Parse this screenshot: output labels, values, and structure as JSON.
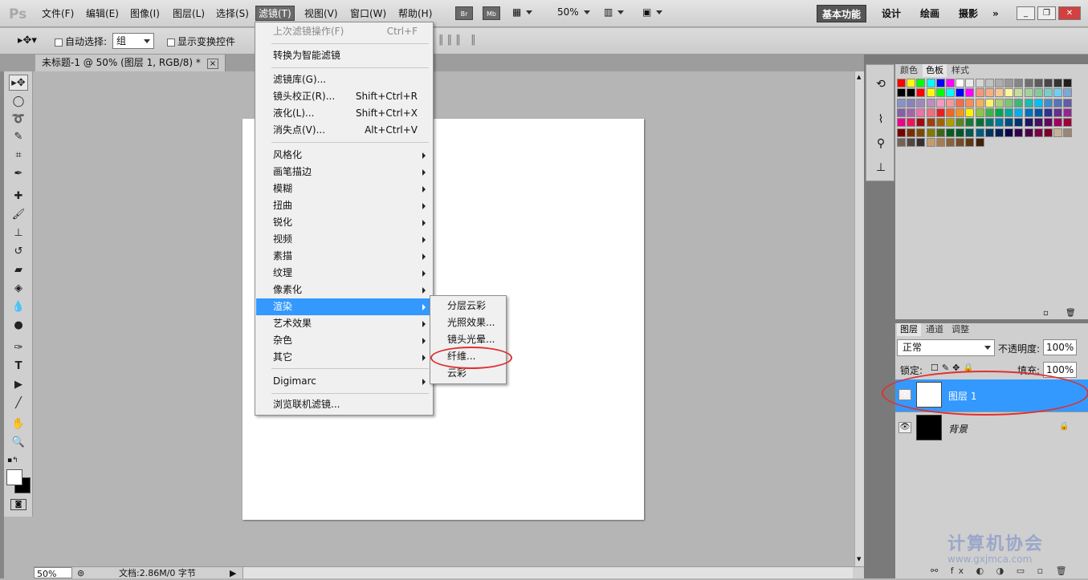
{
  "app": {
    "logo": "Ps"
  },
  "menubar": {
    "items": [
      "文件(F)",
      "编辑(E)",
      "图像(I)",
      "图层(L)",
      "选择(S)",
      "滤镜(T)",
      "视图(V)",
      "窗口(W)",
      "帮助(H)"
    ],
    "bridge_label": "Br",
    "minibridge_label": "Mb",
    "zoom": "50%",
    "workspaces": [
      "基本功能",
      "设计",
      "绘画",
      "摄影"
    ],
    "more": "»"
  },
  "options": {
    "auto_select_label": "自动选择:",
    "auto_select_value": "组",
    "show_transform_label": "显示变换控件"
  },
  "document_tab": {
    "title": "未标题-1 @ 50% (图层 1, RGB/8) *",
    "close": "×"
  },
  "filter_menu": {
    "last_filter": "上次滤镜操作(F)",
    "last_filter_sc": "Ctrl+F",
    "smart": "转换为智能滤镜",
    "gallery": "滤镜库(G)...",
    "lens": "镜头校正(R)...",
    "lens_sc": "Shift+Ctrl+R",
    "liquify": "液化(L)...",
    "liquify_sc": "Shift+Ctrl+X",
    "vanish": "消失点(V)...",
    "vanish_sc": "Alt+Ctrl+V",
    "groups": [
      "风格化",
      "画笔描边",
      "模糊",
      "扭曲",
      "锐化",
      "视频",
      "素描",
      "纹理",
      "像素化",
      "渲染",
      "艺术效果",
      "杂色",
      "其它"
    ],
    "digimarc": "Digimarc",
    "browse": "浏览联机滤镜..."
  },
  "render_submenu": [
    "分层云彩",
    "光照效果...",
    "镜头光晕...",
    "纤维...",
    "云彩"
  ],
  "swatch_panel": {
    "tabs": [
      "颜色",
      "色板",
      "样式"
    ]
  },
  "layers_panel": {
    "tabs": [
      "图层",
      "通道",
      "调整"
    ],
    "blend_mode": "正常",
    "opacity_label": "不透明度:",
    "opacity": "100%",
    "lock_label": "锁定:",
    "fill_label": "填充:",
    "fill": "100%",
    "layers": [
      {
        "name": "图层 1"
      },
      {
        "name": "背景"
      }
    ]
  },
  "status": {
    "zoom": "50%",
    "doc_info": "文档:2.86M/0 字节"
  },
  "watermark": {
    "text": "计算机协会",
    "url": "www.gxjmca.com"
  },
  "colors": {
    "highlight": "#3399ff",
    "annotation": "#e03030"
  }
}
